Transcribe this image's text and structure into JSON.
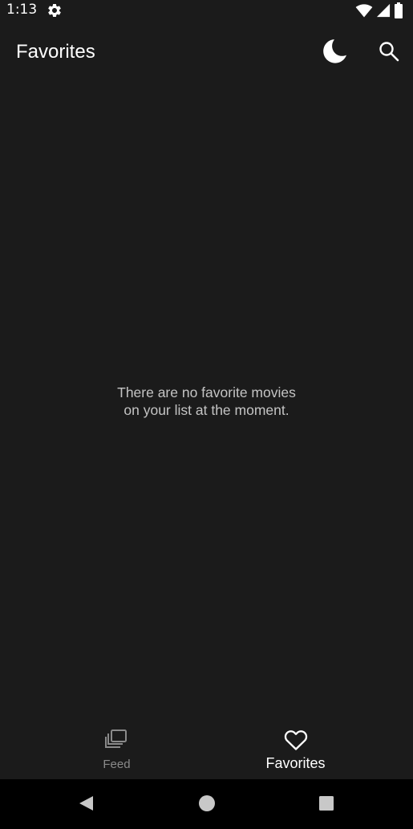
{
  "status_bar": {
    "time": "1:13"
  },
  "app_bar": {
    "title": "Favorites"
  },
  "empty_state": {
    "line1": "There are no favorite movies",
    "line2": "on your list at the moment."
  },
  "bottom_nav": {
    "items": [
      {
        "label": "Feed",
        "icon": "feed-stack-icon",
        "active": false
      },
      {
        "label": "Favorites",
        "icon": "heart-outline-icon",
        "active": true
      }
    ]
  },
  "colors": {
    "background": "#1b1b1b",
    "text_primary": "#ffffff",
    "text_secondary": "#c4c4c4",
    "text_inactive": "#8a8a8a",
    "system_nav": "#000000"
  }
}
